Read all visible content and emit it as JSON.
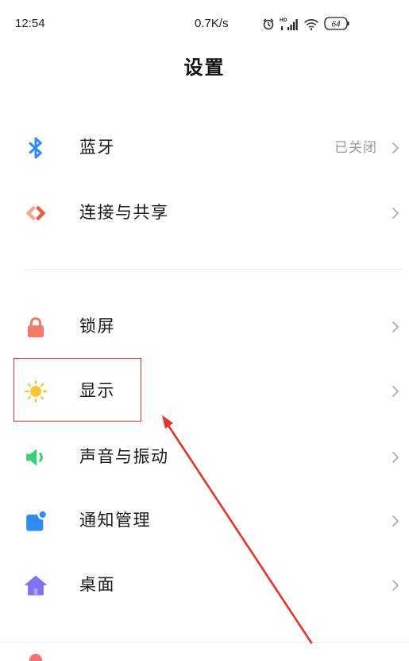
{
  "status_bar": {
    "time": "12:54",
    "net_speed": "0.7K/s",
    "signal_label": "HD",
    "battery_level": "64",
    "icons": [
      "alarm-icon",
      "hd-signal-icon",
      "wifi-icon",
      "battery-icon"
    ]
  },
  "header": {
    "title": "设置"
  },
  "settings": {
    "bluetooth": {
      "label": "蓝牙",
      "value": "已关闭",
      "icon": "bluetooth-icon",
      "color": "#2f8cf2"
    },
    "connection_sharing": {
      "label": "连接与共享",
      "icon": "connection-share-icon",
      "color": "#ef5c43",
      "secondary_color": "#f8a58f"
    },
    "lock_screen": {
      "label": "锁屏",
      "icon": "lock-icon",
      "color": "#f57b67"
    },
    "display": {
      "label": "显示",
      "icon": "sun-icon",
      "color": "#f9c52f"
    },
    "sound_vibration": {
      "label": "声音与振动",
      "icon": "speaker-icon",
      "color": "#3ccf7c"
    },
    "notifications": {
      "label": "通知管理",
      "icon": "notification-icon",
      "color": "#2f8cf2"
    },
    "desktop": {
      "label": "桌面",
      "icon": "home-icon",
      "color": "#7d72ef"
    },
    "partial_item": {
      "icon": "partial-item-icon",
      "color": "#f06e78"
    }
  },
  "chevron_icon": "chevron-right-icon",
  "annotation": {
    "color": "#e3342b"
  }
}
